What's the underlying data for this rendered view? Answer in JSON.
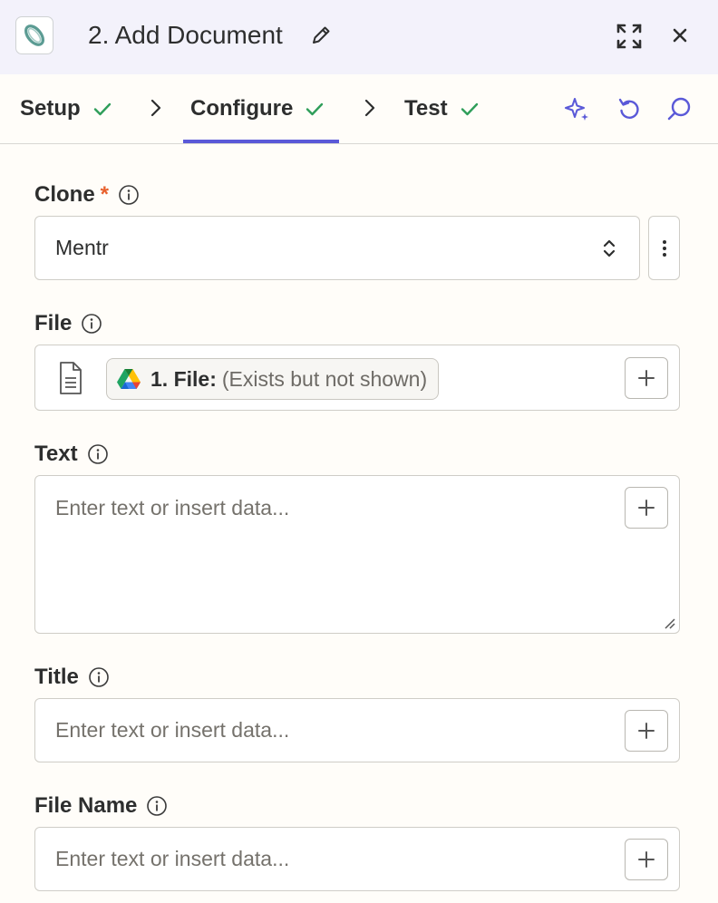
{
  "header": {
    "step_title": "2. Add Document"
  },
  "tabs": [
    {
      "label": "Setup",
      "status": "complete"
    },
    {
      "label": "Configure",
      "status": "complete",
      "active": true
    },
    {
      "label": "Test",
      "status": "complete"
    }
  ],
  "colors": {
    "accent": "#5a59d8",
    "check": "#2f9e5a",
    "required": "#e8602c",
    "header_bg": "#f3f2fb"
  },
  "form": {
    "clone": {
      "label": "Clone",
      "required_mark": "*",
      "value": "Mentr"
    },
    "file": {
      "label": "File",
      "pill_label": "1. File:",
      "pill_value": "(Exists but not shown)"
    },
    "text": {
      "label": "Text",
      "placeholder": "Enter text or insert data..."
    },
    "title": {
      "label": "Title",
      "placeholder": "Enter text or insert data..."
    },
    "file_name": {
      "label": "File Name",
      "placeholder": "Enter text or insert data..."
    }
  }
}
